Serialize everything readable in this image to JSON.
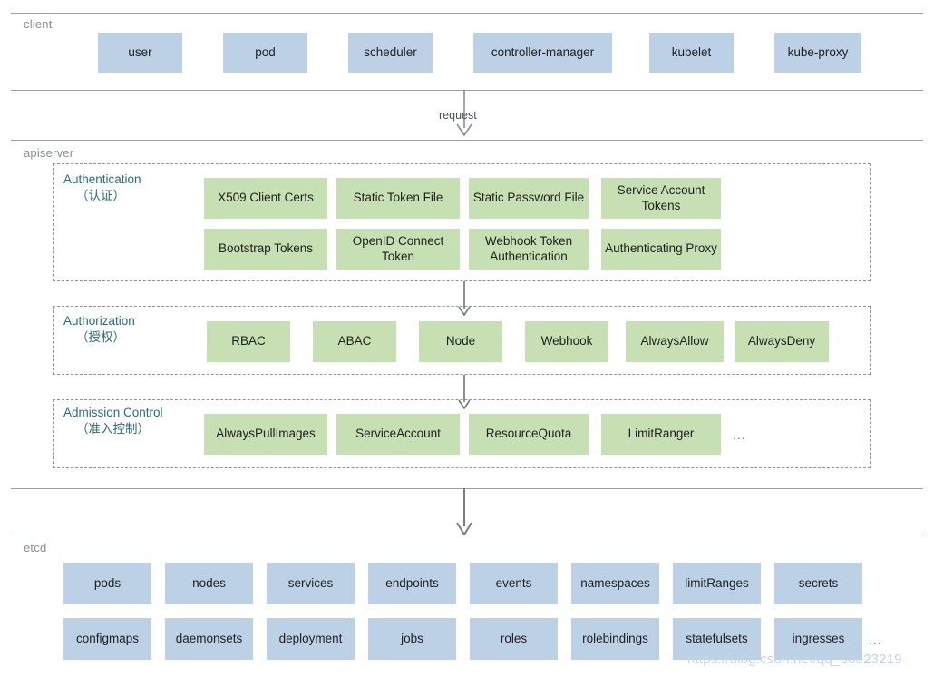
{
  "diagram": {
    "title_fragment": "",
    "colors": {
      "client_box": "#bdd1e6",
      "etcd_box": "#bdd1e6",
      "plugin_box": "#c6e0b3",
      "stage_title": "#2a6b78",
      "band_label": "#8a8f94",
      "rule": "#9aa0a6",
      "arrow": "#7b7f84",
      "watermark": "#c3d3e6"
    },
    "bands": [
      {
        "id": "client",
        "label": "client"
      },
      {
        "id": "apiserver",
        "label": "apiserver"
      },
      {
        "id": "etcd",
        "label": "etcd"
      }
    ],
    "flow": {
      "request_label": "request"
    },
    "client_nodes": [
      {
        "label": "user"
      },
      {
        "label": "pod"
      },
      {
        "label": "scheduler"
      },
      {
        "label": "controller-manager"
      },
      {
        "label": "kubelet"
      },
      {
        "label": "kube-proxy"
      }
    ],
    "stages": [
      {
        "id": "authentication",
        "title_en": "Authentication",
        "title_cn": "（认证）",
        "rows": [
          [
            {
              "label": "X509 Client Certs"
            },
            {
              "label": "Static Token File"
            },
            {
              "label": "Static Password File"
            },
            {
              "label": "Service Account Tokens"
            }
          ],
          [
            {
              "label": "Bootstrap Tokens"
            },
            {
              "label": "OpenID Connect Token"
            },
            {
              "label": "Webhook Token Authentication"
            },
            {
              "label": "Authenticating Proxy"
            }
          ]
        ],
        "ellipsis": ""
      },
      {
        "id": "authorization",
        "title_en": "Authorization",
        "title_cn": "（授权）",
        "rows": [
          [
            {
              "label": "RBAC"
            },
            {
              "label": "ABAC"
            },
            {
              "label": "Node"
            },
            {
              "label": "Webhook"
            },
            {
              "label": "AlwaysAllow"
            },
            {
              "label": "AlwaysDeny"
            }
          ]
        ],
        "ellipsis": ""
      },
      {
        "id": "admission-control",
        "title_en": "Admission Control",
        "title_cn": "（准入控制）",
        "rows": [
          [
            {
              "label": "AlwaysPullImages"
            },
            {
              "label": "ServiceAccount"
            },
            {
              "label": "ResourceQuota"
            },
            {
              "label": "LimitRanger"
            }
          ]
        ],
        "ellipsis": "..."
      }
    ],
    "etcd_rows": [
      [
        {
          "label": "pods"
        },
        {
          "label": "nodes"
        },
        {
          "label": "services"
        },
        {
          "label": "endpoints"
        },
        {
          "label": "events"
        },
        {
          "label": "namespaces"
        },
        {
          "label": "limitRanges"
        },
        {
          "label": "secrets"
        }
      ],
      [
        {
          "label": "configmaps"
        },
        {
          "label": "daemonsets"
        },
        {
          "label": "deployment"
        },
        {
          "label": "jobs"
        },
        {
          "label": "roles"
        },
        {
          "label": "rolebindings"
        },
        {
          "label": "statefulsets"
        },
        {
          "label": "ingresses"
        }
      ]
    ],
    "etcd_ellipsis": "...",
    "watermark": "https://blog.csdn.net/qq_36023219"
  }
}
